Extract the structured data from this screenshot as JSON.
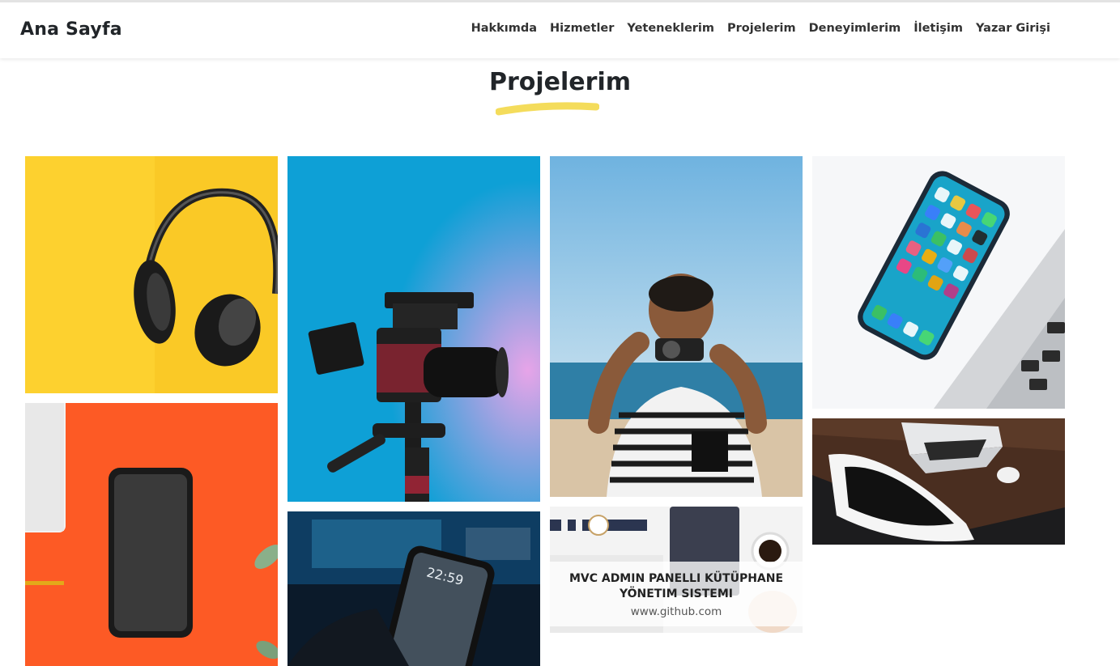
{
  "navbar": {
    "brand": "Ana Sayfa",
    "links": [
      "Hakkımda",
      "Hizmetler",
      "Yeteneklerim",
      "Projelerim",
      "Deneyimlerim",
      "İletişim",
      "Yazar Girişi"
    ]
  },
  "section": {
    "title": "Projelerim"
  },
  "projects": [
    {
      "image": "headphones-on-yellow"
    },
    {
      "image": "smartphone-on-orange"
    },
    {
      "image": "video-camera-on-blue"
    },
    {
      "image": "phone-in-hand-dark"
    },
    {
      "image": "man-photographing-beach"
    },
    {
      "image": "desk-watch-coffee",
      "caption": {
        "title": "MVC ADMIN PANELLI KÜTÜPHANE YÖNETIM SISTEMI",
        "link": "www.github.com"
      }
    },
    {
      "image": "iphone-on-laptop"
    },
    {
      "image": "laptop-on-desk-dark"
    }
  ],
  "colors": {
    "accent_underline": "#f4dc5b",
    "yellow_bg": "#fdd12f",
    "orange_bg": "#fd5a25",
    "blue_bg": "#0ea0d6"
  }
}
